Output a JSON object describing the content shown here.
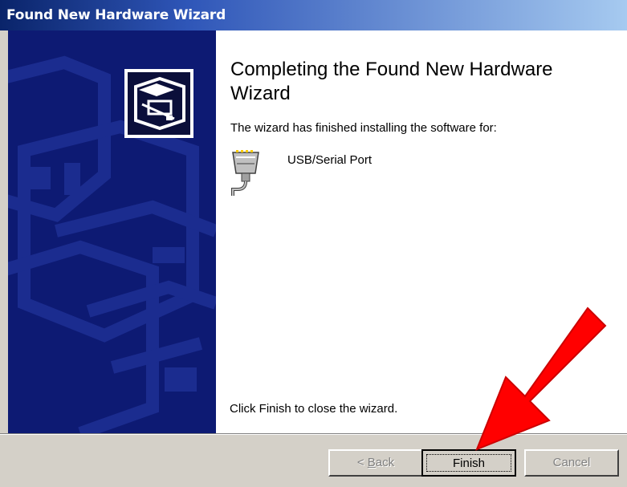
{
  "window": {
    "title": "Found New Hardware Wizard"
  },
  "content": {
    "heading": "Completing the Found New Hardware Wizard",
    "installed_message": "The wizard has finished installing the software for:",
    "device_name": "USB/Serial Port",
    "device_icon": "serial-port-icon",
    "close_message": "Click Finish to close the wizard."
  },
  "buttons": {
    "back_prefix": "< ",
    "back_accel": "B",
    "back_rest": "ack",
    "finish": "Finish",
    "cancel": "Cancel"
  },
  "colors": {
    "side_panel": "#0d1a73",
    "annotation_arrow": "#ff0000"
  }
}
